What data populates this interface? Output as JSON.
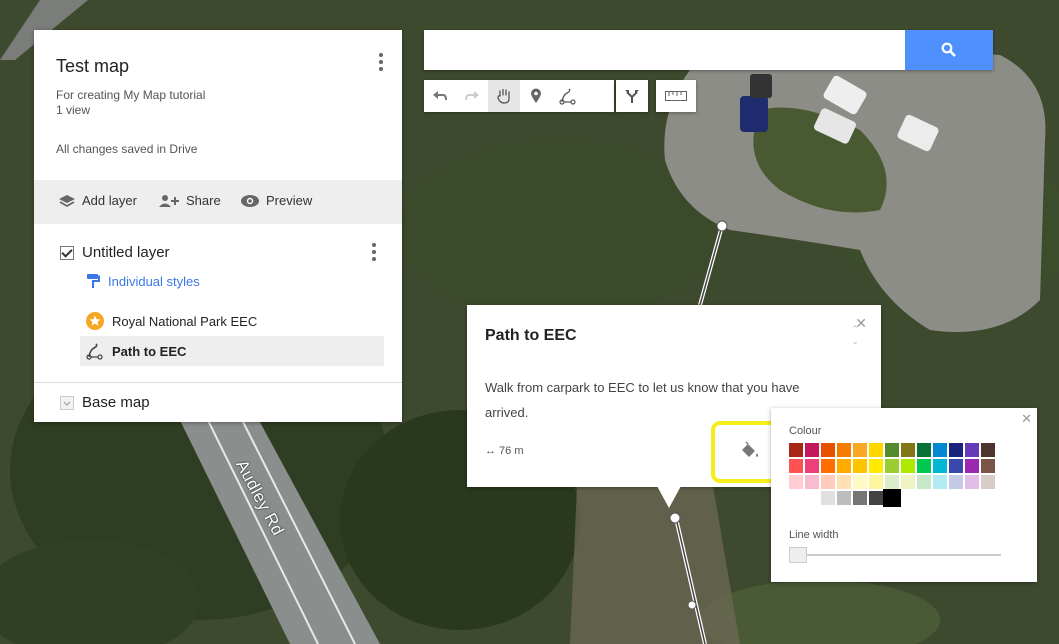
{
  "map": {
    "road_label": "Audley Rd",
    "path_color": "#ffffff",
    "vertex_color": "#ffffff"
  },
  "panel": {
    "title": "Test map",
    "description": "For creating My Map tutorial",
    "views": "1 view",
    "saved_status": "All changes saved in Drive",
    "actions": {
      "add_layer": "Add layer",
      "share": "Share",
      "preview": "Preview"
    },
    "layer": {
      "name": "Untitled layer",
      "style": "Individual styles",
      "items": [
        {
          "label": "Royal National Park EEC",
          "icon": "star-marker-icon"
        },
        {
          "label": "Path to EEC",
          "icon": "line-icon"
        }
      ]
    },
    "base_map": "Base map"
  },
  "search": {
    "placeholder": "",
    "button_color": "#4d90fe",
    "icon": "search-icon"
  },
  "toolbar": {
    "tools": [
      "undo-icon",
      "redo-icon",
      "hand-icon",
      "marker-icon",
      "draw-line-icon",
      "directions-icon",
      "ruler-icon"
    ]
  },
  "popup": {
    "title": "Path to EEC",
    "description": "Walk from carpark to EEC to let us know that you have arrived.",
    "distance": "↔ 76 m"
  },
  "palette": {
    "label": "Colour",
    "line_width_label": "Line width",
    "line_width_fraction": 0.0,
    "selected": "#000000",
    "rows": [
      [
        "#a52714",
        "#c2185b",
        "#e65100",
        "#f57c00",
        "#f9a825",
        "#ffd600",
        "#558b2f",
        "#817717",
        "#097138",
        "#0288d1",
        "#1a237e",
        "#673ab7",
        "#4e342e"
      ],
      [
        "#ff5252",
        "#ec407a",
        "#ff6d00",
        "#ffab00",
        "#ffc400",
        "#ffea00",
        "#9acd32",
        "#aeea00",
        "#00c853",
        "#00b8d4",
        "#3949ab",
        "#9c27b0",
        "#795548"
      ],
      [
        "#ffcdd2",
        "#f8bbd0",
        "#ffccbc",
        "#ffe0b2",
        "#fff9c4",
        "#fff59d",
        "#dcedc8",
        "#f0f4c3",
        "#c8e6c9",
        "#b2ebf2",
        "#c5cae9",
        "#e1bee7",
        "#d7ccc8"
      ],
      [
        "#ffffff",
        "#e0e0e0",
        "#bdbdbd",
        "#757575",
        "#424242",
        "#000000"
      ]
    ]
  }
}
